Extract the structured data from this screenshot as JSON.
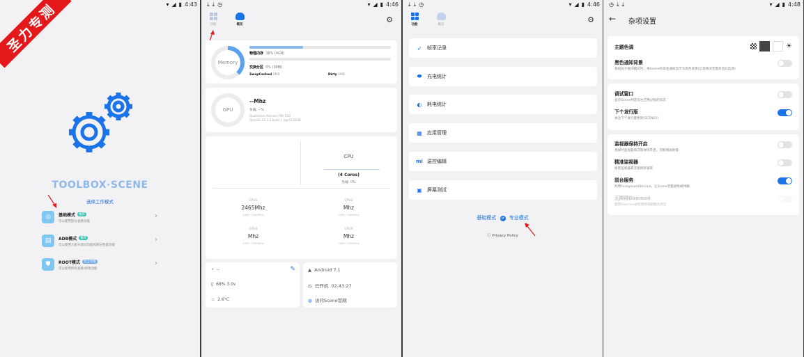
{
  "status_bars": [
    {
      "time": "4:43"
    },
    {
      "time": "4:46"
    },
    {
      "time": "4:46"
    },
    {
      "time": "4:48"
    }
  ],
  "banner_text": "圣力专测",
  "home": {
    "app_name": "TOOLBOX·SCENE",
    "choose_mode": "选择工作模式",
    "modes": [
      {
        "title": "基础模式",
        "badge": "推荐",
        "desc": "可以使用部分查看功能"
      },
      {
        "title": "ADB模式",
        "badge": "推荐",
        "desc": "可以使用大部分调试功能和部分性能功能"
      },
      {
        "title": "ROOT模式",
        "badge": "完全功能",
        "desc": "可以使用所有查看/修改功能"
      }
    ]
  },
  "overview": {
    "tabs": {
      "func": "功能",
      "overview": "概览"
    },
    "memory": {
      "ring_label": "Memory",
      "phys_label": "物理内存",
      "phys_value": "38% (4GB)",
      "phys_fill": 0.38,
      "swap_label": "交换分区",
      "swap_value": "0% (0MB)",
      "swapcached_label": "SwapCached",
      "swapcached_value": "0MB",
      "dirty_label": "Dirty",
      "dirty_value": "0MB"
    },
    "gpu": {
      "ring_label": "GPU",
      "freq": "--Mhz",
      "load": "负载: --%",
      "renderer": "Qualcomm Adreno (TM) 510",
      "version": "OpenGL ES 3.2 build 1.4@(GC4208"
    },
    "cpu": {
      "label": "CPU",
      "cores": "(4 Cores)",
      "load": "负载: 0%",
      "cells": [
        {
          "name": "CPU1",
          "freq": "2465Mhz",
          "range": "2465~2465Mhz"
        },
        {
          "name": "CPU2",
          "freq": "Mhz",
          "range": "2465~2465Mhz"
        },
        {
          "name": "CPU3",
          "freq": "Mhz",
          "range": "2465~2465Mhz"
        },
        {
          "name": "CPU4",
          "freq": "Mhz",
          "range": "2465~2465Mhz"
        }
      ]
    },
    "battery": {
      "charge": "--",
      "level": "68%  3.0v",
      "temp": "2.6°C"
    },
    "system": {
      "android": "Android 7.1",
      "uptime_label": "已开机",
      "uptime": "02:43:27",
      "visit": "访问Scene官网"
    }
  },
  "functions": {
    "tabs": {
      "func": "功能",
      "overview": "概览"
    },
    "items": [
      {
        "label": "帧率记录",
        "icon": "run-icon"
      },
      {
        "label": "充电统计",
        "icon": "charge-icon"
      },
      {
        "label": "耗电统计",
        "icon": "drain-icon"
      },
      {
        "label": "应用管理",
        "icon": "apps-icon"
      },
      {
        "label": "温控编辑",
        "icon": "mi-icon"
      },
      {
        "label": "屏幕测试",
        "icon": "screen-icon"
      }
    ],
    "basic_mode": "基础模式",
    "pro_mode": "专业模式",
    "privacy": "Privacy Policy"
  },
  "settings": {
    "title": "杂项设置",
    "theme_label": "主题色调",
    "black_bg": {
      "title": "黑色通知背景",
      "desc": "系统处于夜间模式时，将Scene的常驻通知显示为黑色背景(正常情况无需开启此选项)",
      "on": false
    },
    "debug": {
      "title": "调试窗口",
      "desc": "显示Scene判定前台应用过程的日志",
      "on": false
    },
    "next": {
      "title": "下个发行版",
      "desc": "关注下个发行版更新(SCENE6)",
      "on": true
    },
    "monitor_keep": {
      "title": "监视器保持开启",
      "desc": "息屏时监视器悬浮窗保持开启，可能增加耗电",
      "on": false
    },
    "precise": {
      "title": "精准监视器",
      "desc": "极客监视器悬浮窗刷新速率",
      "on": false
    },
    "foreground": {
      "title": "前台服务",
      "desc": "利用ForegroundService，让Scene尽量避免被休眠",
      "on": true
    },
    "daemon": {
      "title": "无障碍Daemon",
      "desc": "使用Daemon进程保持辅助服务存活",
      "on": false
    }
  },
  "colors": {
    "accent": "#1a73e8",
    "red": "#e4171b",
    "bg": "#f2f2f4"
  }
}
